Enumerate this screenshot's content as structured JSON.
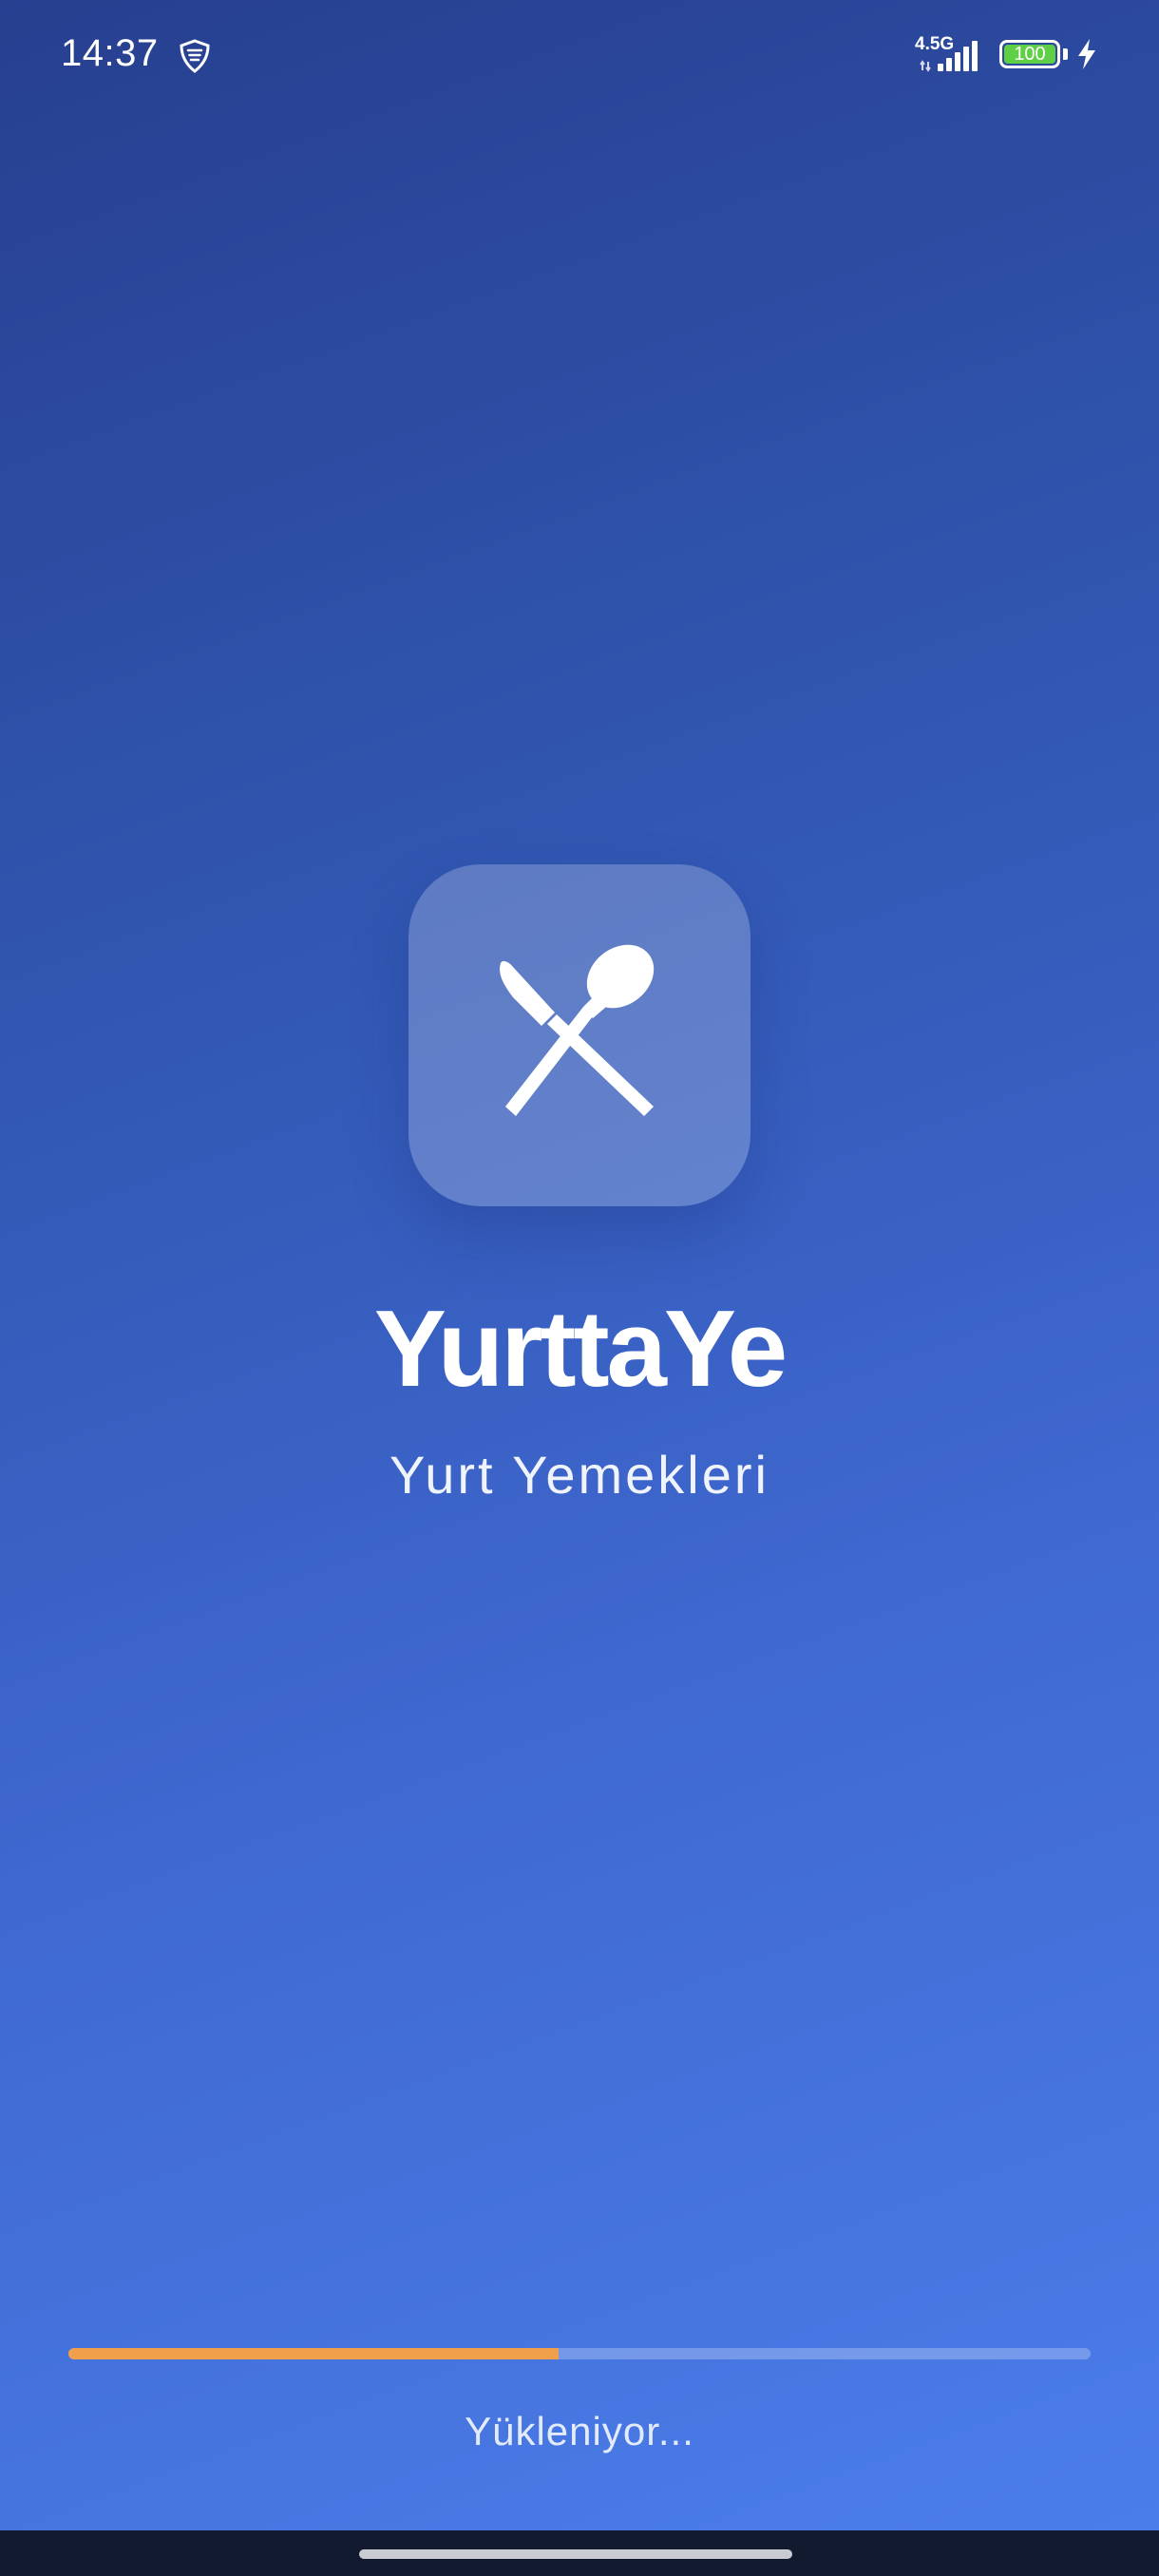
{
  "status_bar": {
    "time": "14:37",
    "network_type": "4.5G",
    "battery_level": "100",
    "vpn_icon": "vpn-shield-icon",
    "signal_icon": "cellular-signal-icon",
    "charging_icon": "charging-bolt-icon"
  },
  "app": {
    "logo_icon": "fork-spoon-utensils-icon",
    "title": "YurttaYe",
    "subtitle": "Yurt Yemekleri"
  },
  "loading": {
    "progress": 0.48,
    "label": "Yükleniyor..."
  },
  "colors": {
    "background_top": "#273f8f",
    "background_bottom": "#4b7eea",
    "progress_fill": "#f0a04a",
    "battery_fill": "#5fcf45",
    "nav_bar": "#111a2e"
  }
}
